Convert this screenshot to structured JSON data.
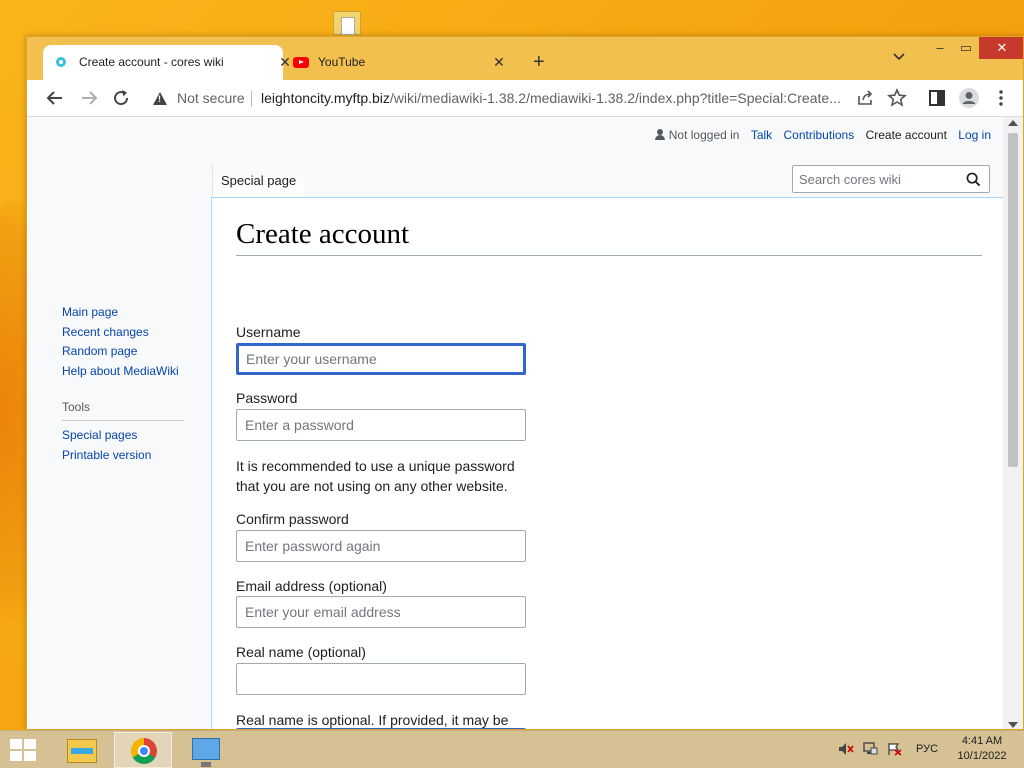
{
  "browser": {
    "tabs": [
      {
        "title": "Create account - cores wiki",
        "active": true
      },
      {
        "title": "YouTube",
        "active": false
      }
    ],
    "new_tab_label": "+",
    "close_glyph": "✕",
    "window_controls": {
      "minimize": "–",
      "maximize": "▭",
      "close": "✕"
    },
    "omnibox": {
      "security_text": "Not secure",
      "url_host": "leightoncity.myftp.biz",
      "url_path": "/wiki/mediawiki-1.38.2/mediawiki-1.38.2/index.php?title=Special:Create..."
    }
  },
  "wiki": {
    "personal_tools": {
      "not_logged_in": "Not logged in",
      "talk": "Talk",
      "contributions": "Contributions",
      "create_account": "Create account",
      "log_in": "Log in"
    },
    "page_tab": "Special page",
    "search_placeholder": "Search cores wiki",
    "sidebar": {
      "navigation": [
        "Main page",
        "Recent changes",
        "Random page",
        "Help about MediaWiki"
      ],
      "tools_heading": "Tools",
      "tools": [
        "Special pages",
        "Printable version"
      ]
    },
    "heading": "Create account",
    "form": {
      "username_label": "Username",
      "username_placeholder": "Enter your username",
      "password_label": "Password",
      "password_placeholder": "Enter a password",
      "password_help": "It is recommended to use a unique password that you are not using on any other website.",
      "confirm_label": "Confirm password",
      "confirm_placeholder": "Enter password again",
      "email_label": "Email address (optional)",
      "email_placeholder": "Enter your email address",
      "realname_label": "Real name (optional)",
      "realname_placeholder": "",
      "realname_help": "Real name is optional. If provided, it may be used to give you attribution for your work."
    }
  },
  "taskbar": {
    "language": "РУС",
    "time": "4:41 AM",
    "date": "10/1/2022"
  },
  "colors": {
    "link": "#0645ad",
    "accent": "#3366cc",
    "desktop": "#f6a712"
  }
}
